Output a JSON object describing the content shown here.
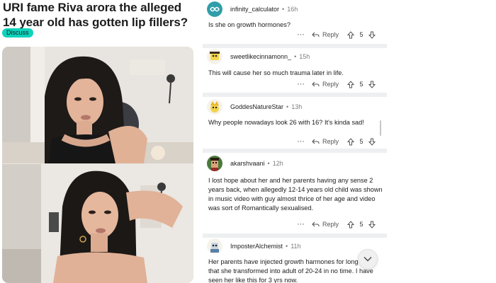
{
  "post": {
    "title": "URI fame Riva arora the alleged 14 year old has gotten lip fillers?",
    "flair": "Discuss",
    "flair_color": "#0dd3bb",
    "media_alt": [
      "photo-top",
      "photo-bottom"
    ]
  },
  "comments": [
    {
      "username": "infinity_calculator",
      "time": "16h",
      "avatar_icon": "infinity-avatar-icon",
      "body": "Is she on growth hormones?",
      "reply_label": "Reply",
      "votes": "5"
    },
    {
      "username": "sweetlikecinnamonn_",
      "time": "15h",
      "avatar_icon": "snoo-avatar-icon",
      "body": "This will cause her so much trauma later in life.",
      "reply_label": "Reply",
      "votes": "5"
    },
    {
      "username": "GoddesNatureStar",
      "time": "13h",
      "avatar_icon": "snoo-avatar-icon",
      "body": "Why people nowadays look 26 with 16? It's kinda sad!",
      "reply_label": "Reply",
      "votes": "5"
    },
    {
      "username": "akarshvaani",
      "time": "12h",
      "avatar_icon": "pixel-avatar-icon",
      "body": "I lost hope about her and her parents having any sense 2 years back, when allegedly 12-14 years old child was shown in music video with guy almost thrice of her age and video was sort of Romantically sexualised.",
      "reply_label": "Reply",
      "votes": "5"
    },
    {
      "username": "ImposterAlchemist",
      "time": "11h",
      "avatar_icon": "snoo-avatar-icon",
      "body": "Her parents have injected growth harmones for long time that she transformed into adult of 20-24 in no time. I have seen her like this for 3 yrs now."
    }
  ],
  "dot": "•",
  "colors": {
    "accent": "#0dd3bb",
    "divider": "#edeff1",
    "meta": "#7c7c7c"
  }
}
